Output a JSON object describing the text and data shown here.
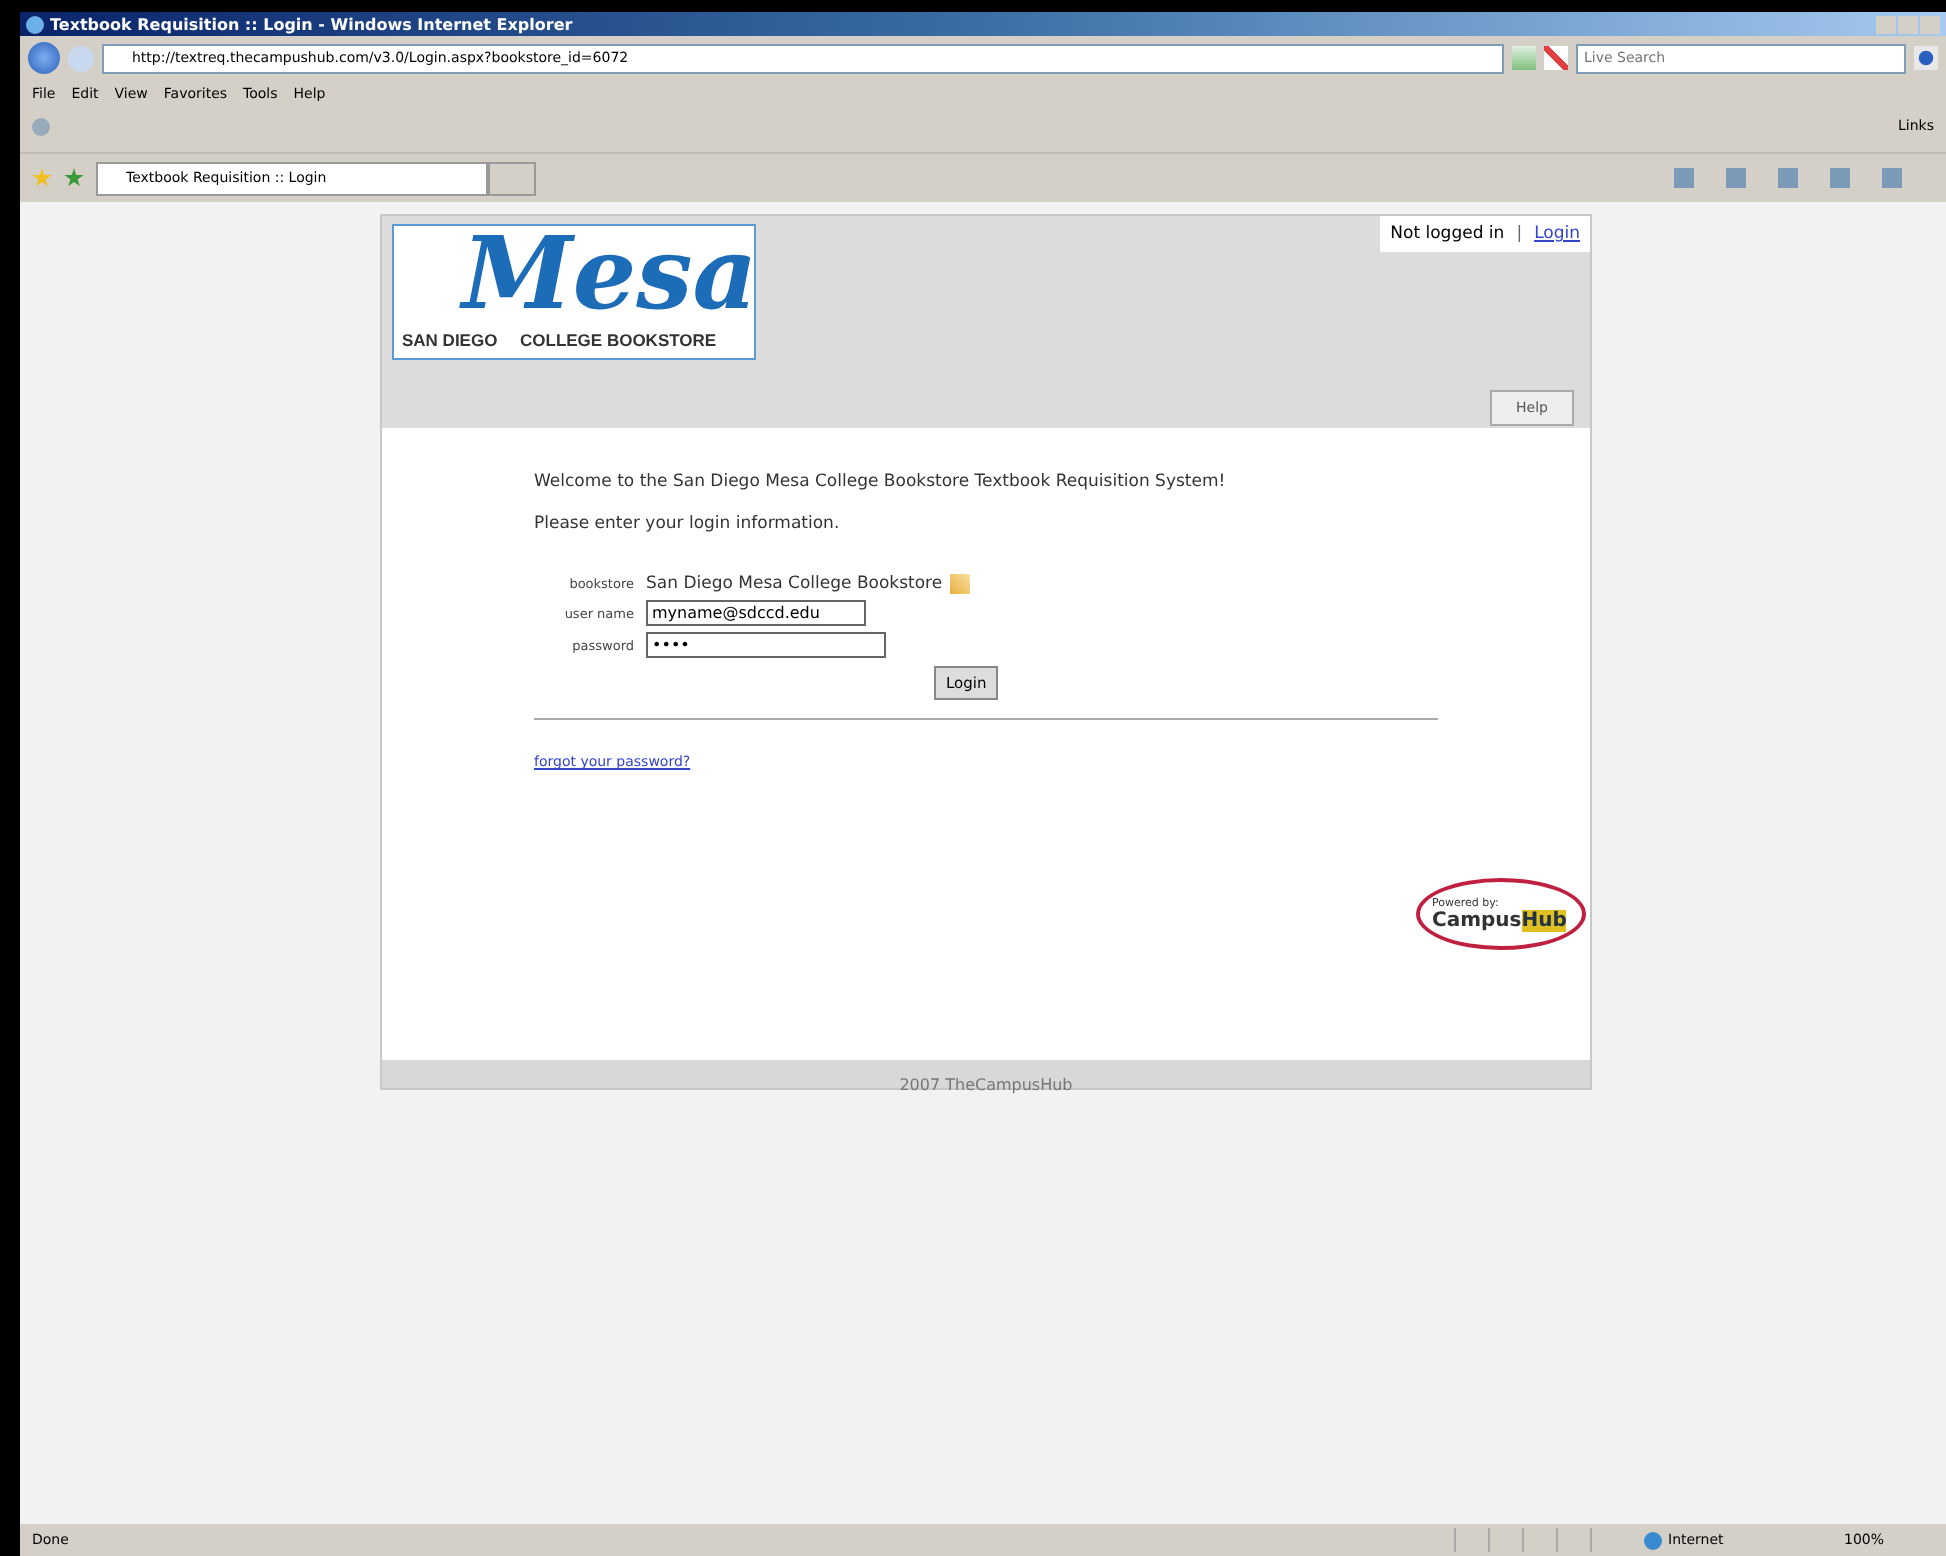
{
  "window": {
    "title": "Textbook Requisition :: Login - Windows Internet Explorer"
  },
  "address_bar": {
    "url": "http://textreq.thecampushub.com/v3.0/Login.aspx?bookstore_id=6072"
  },
  "search": {
    "placeholder": "Live Search"
  },
  "menu": [
    "File",
    "Edit",
    "View",
    "Favorites",
    "Tools",
    "Help"
  ],
  "links_label": "Links",
  "tab": {
    "label": "Textbook Requisition :: Login",
    "selected": true
  },
  "page": {
    "logo": {
      "word": "Mesa",
      "left": "SAN DIEGO",
      "right": "COLLEGE BOOKSTORE"
    },
    "status": {
      "text": "Not logged in",
      "separator": "|",
      "link": "Login"
    },
    "help_button": "Help",
    "welcome": "Welcome to the San Diego Mesa College Bookstore Textbook Requisition System!",
    "instruction": "Please enter your login information.",
    "form": {
      "bookstore_label": "bookstore",
      "bookstore_value": "San Diego Mesa College Bookstore",
      "username_label": "user name",
      "username_value": "myname@sdccd.edu",
      "password_label": "password",
      "password_value": "••••",
      "button": "Login"
    },
    "forgot_link": "forgot your password?",
    "powered": {
      "text": "Powered by:",
      "brand_left": "Campus",
      "brand_right": "Hub"
    },
    "footer": "2007 TheCampusHub"
  },
  "status_bar": {
    "text": "Done",
    "zone": "Internet",
    "zoom": "100%"
  }
}
